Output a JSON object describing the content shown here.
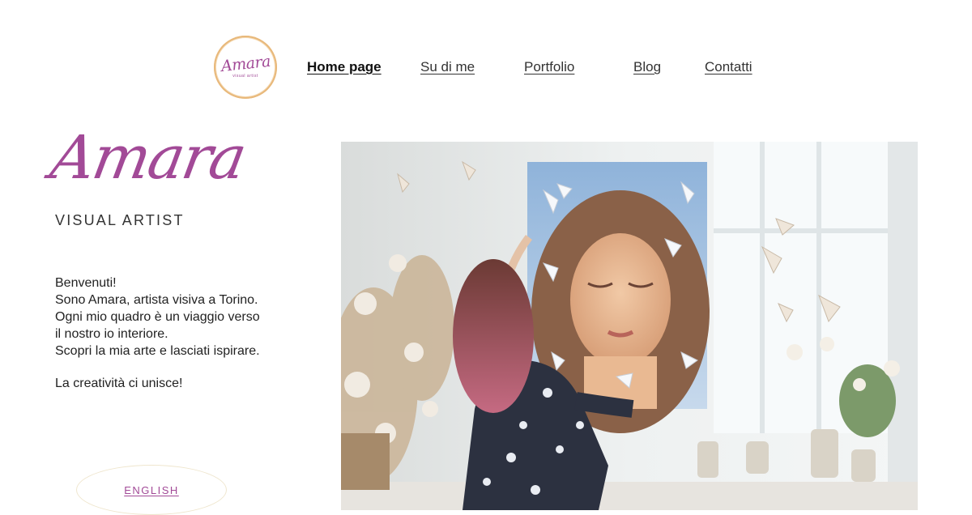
{
  "logo": {
    "script": "Amara",
    "sub": "visual artist"
  },
  "nav": {
    "home": "Home page",
    "about": "Su di me",
    "portfolio": "Portfolio",
    "blog": "Blog",
    "contact": "Contatti"
  },
  "brand": {
    "name": "Amara",
    "subtitle": "VISUAL ARTIST"
  },
  "intro": {
    "lines": [
      "Benvenuti!",
      "Sono Amara, artista visiva a Torino.",
      "Ogni mio quadro è un viaggio verso",
      "il nostro io interiore.",
      "Scopri la mia arte e lasciati ispirare."
    ],
    "tagline": "La creatività ci unisce!"
  },
  "language_button": "ENGLISH",
  "colors": {
    "accent": "#a24a97",
    "logo_ring": "#e8b87a",
    "text": "#333333"
  },
  "hero_image": {
    "icon": "artist-studio-photo"
  }
}
